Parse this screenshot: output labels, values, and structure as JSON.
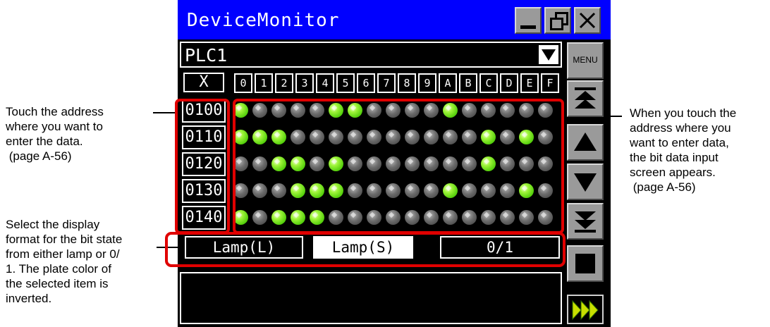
{
  "window": {
    "title": "DeviceMonitor"
  },
  "plc_selector": {
    "value": "PLC1"
  },
  "menu_button": {
    "label": "MENU"
  },
  "grid": {
    "device": "X",
    "columns": [
      "0",
      "1",
      "2",
      "3",
      "4",
      "5",
      "6",
      "7",
      "8",
      "9",
      "A",
      "B",
      "C",
      "D",
      "E",
      "F"
    ],
    "rows": [
      {
        "address": "0100",
        "bits": [
          1,
          0,
          0,
          0,
          0,
          1,
          1,
          0,
          0,
          0,
          0,
          1,
          0,
          0,
          0,
          0,
          0
        ]
      },
      {
        "address": "0110",
        "bits": [
          1,
          1,
          1,
          0,
          0,
          0,
          0,
          0,
          0,
          0,
          0,
          0,
          0,
          1,
          0,
          1,
          0
        ]
      },
      {
        "address": "0120",
        "bits": [
          0,
          0,
          1,
          1,
          0,
          1,
          0,
          0,
          0,
          0,
          0,
          0,
          0,
          1,
          0,
          0,
          0
        ]
      },
      {
        "address": "0130",
        "bits": [
          0,
          0,
          0,
          1,
          1,
          1,
          0,
          0,
          0,
          0,
          0,
          1,
          0,
          0,
          0,
          1,
          0
        ]
      },
      {
        "address": "0140",
        "bits": [
          1,
          0,
          1,
          1,
          1,
          0,
          0,
          0,
          0,
          0,
          0,
          0,
          0,
          0,
          0,
          0,
          0
        ]
      }
    ]
  },
  "format_buttons": [
    {
      "label": "Lamp(L)",
      "selected": false
    },
    {
      "label": "Lamp(S)",
      "selected": true
    },
    {
      "label": "0/1",
      "selected": false
    }
  ],
  "callouts": {
    "address": [
      "Touch the address",
      "where you want to",
      "enter the data.",
      " (page A-56)"
    ],
    "format": [
      "Select the display",
      "format for the bit state",
      "from either lamp or 0/",
      "1. The plate color of",
      "the selected item is",
      "inverted."
    ],
    "bits": [
      "When you touch the",
      "address where you",
      "want to enter data,",
      "the bit data input",
      "screen appears.",
      " (page A-56)"
    ]
  },
  "colors": {
    "title_bar": "#0000ff",
    "lamp_on": "#66dd11",
    "highlight": "#e00000",
    "selected_plate": "#ffffff"
  }
}
